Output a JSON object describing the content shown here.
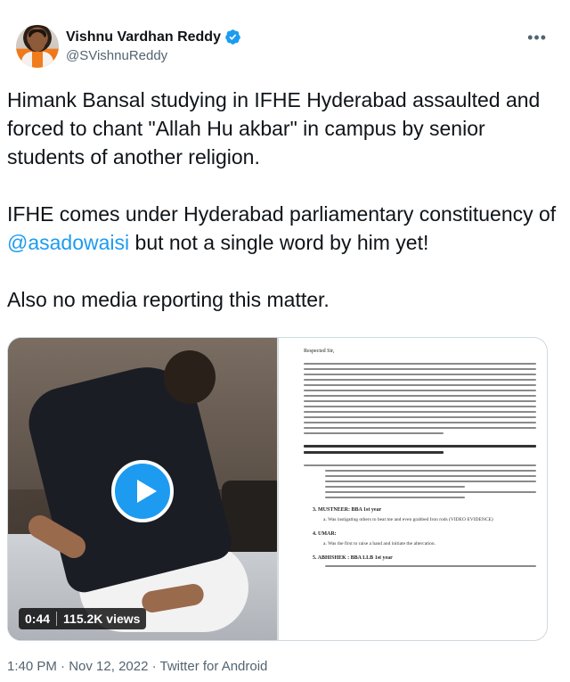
{
  "author": {
    "display_name": "Vishnu Vardhan Reddy",
    "handle": "@SVishnuReddy"
  },
  "more_icon": "more-horizontal-icon",
  "tweet": {
    "para1": "Himank Bansal studying in IFHE Hyderabad assaulted and forced to chant \"Allah Hu akbar\" in campus by senior students of another religion.",
    "para2_before": "IFHE comes under Hyderabad parliamentary constituency of ",
    "para2_mention": "@asadowaisi",
    "para2_after": " but not a single word by him yet!",
    "para3": "Also no media reporting this matter."
  },
  "video": {
    "duration": "0:44",
    "views": "115.2K views"
  },
  "document": {
    "greeting": "Respected Sir,",
    "label_mustneer": "3. MUSTNEER: BBA 1st year",
    "label_umar": "4. UMAR:",
    "label_abhishek": "5. ABHISHEK : BBA LLB 1st year",
    "sub_mustneer": "a. Was instigating others to beat me and even grabbed Iron rods (VIDEO EVIDENCE)",
    "sub_umar": "a. Was the first to raise a hand and initiate the altercation."
  },
  "meta": {
    "time": "1:40 PM",
    "dot": " · ",
    "date": "Nov 12, 2022",
    "source": "Twitter for Android"
  },
  "colors": {
    "accent": "#1d9bf0",
    "secondary_text": "#536471",
    "primary_text": "#0f1419"
  }
}
